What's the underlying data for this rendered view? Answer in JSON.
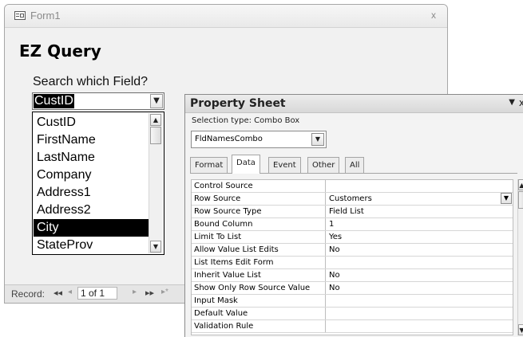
{
  "form": {
    "title": "Form1",
    "close_glyph": "x",
    "heading": "EZ Query",
    "search_label": "Search which Field?",
    "combo_value": "CustID",
    "dropdown_items": [
      "CustID",
      "FirstName",
      "LastName",
      "Company",
      "Address1",
      "Address2",
      "City",
      "StateProv"
    ],
    "selected_item": "City",
    "nav": {
      "label": "Record:",
      "first_glyph": "◂◂",
      "prev_glyph": "◂",
      "current": "1 of 1",
      "next_glyph": "▸",
      "last_glyph": "▸▸",
      "new_glyph": "▸*"
    }
  },
  "property_sheet": {
    "title": "Property Sheet",
    "menu_glyph": "▼",
    "close_glyph": "x",
    "selection_type": "Selection type:  Combo Box",
    "object_combo": "FldNamesCombo",
    "tabs": [
      "Format",
      "Data",
      "Event",
      "Other",
      "All"
    ],
    "active_tab": "Data",
    "rows": [
      {
        "label": "Control Source",
        "value": ""
      },
      {
        "label": "Row Source",
        "value": "Customers"
      },
      {
        "label": "Row Source Type",
        "value": "Field List"
      },
      {
        "label": "Bound Column",
        "value": "1"
      },
      {
        "label": "Limit To List",
        "value": "Yes"
      },
      {
        "label": "Allow Value List Edits",
        "value": "No"
      },
      {
        "label": "List Items Edit Form",
        "value": ""
      },
      {
        "label": "Inherit Value List",
        "value": "No"
      },
      {
        "label": "Show Only Row Source Value",
        "value": "No"
      },
      {
        "label": "Input Mask",
        "value": ""
      },
      {
        "label": "Default Value",
        "value": ""
      },
      {
        "label": "Validation Rule",
        "value": ""
      }
    ]
  },
  "icons": {
    "form_icon": "form-icon",
    "dropdown_arrow": "chevron-down-icon"
  },
  "colors": {
    "selection_bg": "#000000",
    "selection_fg": "#ffffff",
    "window_bg": "#f1f1f1"
  }
}
